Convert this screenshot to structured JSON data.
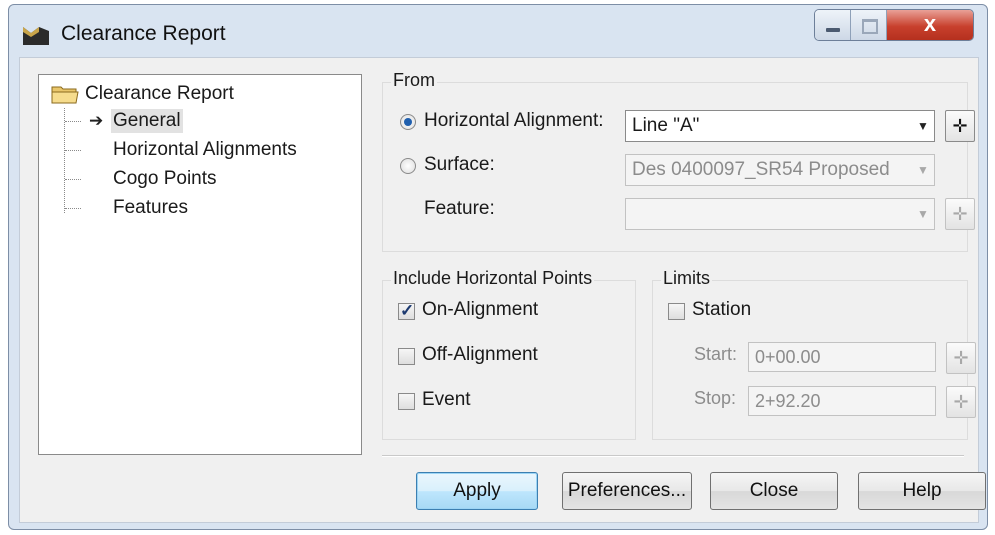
{
  "window": {
    "title": "Clearance Report",
    "close_glyph": "x"
  },
  "tree": {
    "root_label": "Clearance Report",
    "items": [
      {
        "label": "General",
        "selected": true
      },
      {
        "label": "Horizontal Alignments"
      },
      {
        "label": "Cogo Points"
      },
      {
        "label": "Features"
      }
    ]
  },
  "from": {
    "legend": "From",
    "horizontal_alignment_label": "Horizontal Alignment:",
    "horizontal_alignment_value": "Line \"A\"",
    "surface_label": "Surface:",
    "surface_value": "Des 0400097_SR54 Proposed",
    "feature_label": "Feature:",
    "feature_value": "",
    "selected_option": "Horizontal Alignment"
  },
  "include_points": {
    "legend": "Include Horizontal Points",
    "on_alignment_label": "On-Alignment",
    "on_alignment_checked": true,
    "off_alignment_label": "Off-Alignment",
    "off_alignment_checked": false,
    "event_label": "Event",
    "event_checked": false
  },
  "limits": {
    "legend": "Limits",
    "station_label": "Station",
    "station_checked": false,
    "start_label": "Start:",
    "start_value": "0+00.00",
    "stop_label": "Stop:",
    "stop_value": "2+92.20"
  },
  "buttons": {
    "apply": "Apply",
    "preferences": "Preferences...",
    "close": "Close",
    "help": "Help"
  },
  "icons": {
    "app": "app-icon",
    "folder": "folder-icon",
    "arrow": "arrow-right-icon",
    "pick": "crosshair-icon",
    "dropdown": "chevron-down-icon"
  }
}
